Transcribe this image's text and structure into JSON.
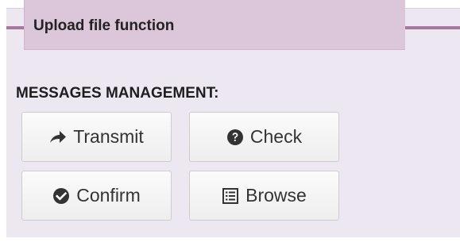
{
  "panel": {
    "title": "Upload file function",
    "accent_color": "#a8779d",
    "title_background": "#dcc7da",
    "body_background": "#ece7f0"
  },
  "messages": {
    "heading": "MESSAGES MANAGEMENT:",
    "buttons": [
      {
        "label": "Transmit",
        "icon": "arrow-right-icon"
      },
      {
        "label": "Check",
        "icon": "question-circle-icon"
      },
      {
        "label": "Confirm",
        "icon": "check-circle-icon"
      },
      {
        "label": "Browse",
        "icon": "list-alt-icon"
      }
    ]
  }
}
